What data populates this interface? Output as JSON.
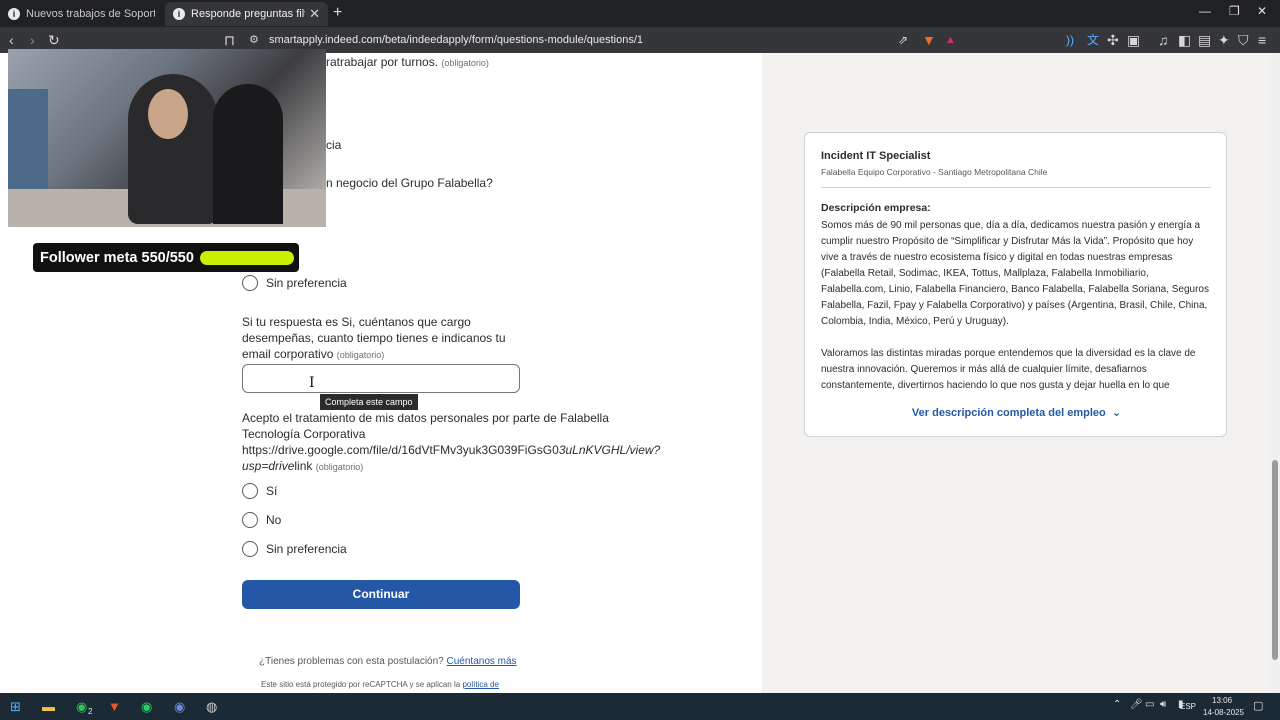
{
  "browser": {
    "tabs": [
      {
        "title": "Nuevos trabajos de Soporte IT en Sa",
        "active": false
      },
      {
        "title": "Responde preguntas filtro de la",
        "active": true
      }
    ],
    "url": "smartapply.indeed.com/beta/indeedapply/form/questions-module/questions/1"
  },
  "form": {
    "partial_q1_text": "ratrabajar por turnos.",
    "required_label": "(obligatorio)",
    "partial_option_text": "cia",
    "partial_q2_text": "n negocio del Grupo Falabella?",
    "q2_last_option": "Sin preferencia",
    "q3_text": "Si tu respuesta es Si, cuéntanos que cargo desempeñas, cuanto tiempo tienes e indicanos tu email corporativo",
    "q3_input_value": "",
    "tooltip": "Completa este campo",
    "q4_line1": "Acepto el tratamiento de mis datos personales por parte de Falabella Tecnología Corporativa",
    "q4_link_plain": "https://drive.google.com/file/d/16dVtFMv3yuk3G039FiGsG0",
    "q4_link_italic": "3uLnKVGHL/view?usp=drive",
    "q4_link_end": "link",
    "q4_options": [
      "Sí",
      "No",
      "Sin preferencia"
    ],
    "continue_button": "Continuar",
    "footer_question": "¿Tienes problemas con esta postulación?",
    "footer_link": "Cuéntanos más",
    "footer_recaptcha": "Este sitio está protegido por reCAPTCHA y se aplican la",
    "footer_recaptcha_link": "política de"
  },
  "job": {
    "title": "Incident IT Specialist",
    "company": "Falabella Equipo Corporativo - Santiago Metropolitana Chile",
    "desc_heading": "Descripción empresa:",
    "desc_p1": "Somos más de 90 mil personas que, día a día, dedicamos nuestra pasión y energía a cumplir nuestro Propósito de “Simplificar y Disfrutar Más la Vida”. Propósito que hoy vive a través de nuestro ecosistema físico y digital en todas nuestras empresas (Falabella Retail, Sodimac, IKEA, Tottus, Mallplaza, Falabella Inmobiliario, Falabella.com, Linio, Falabella Financiero, Banco Falabella, Falabella Soriana, Seguros Falabella, Fazil, Fpay y Falabella Corporativo) y países (Argentina, Brasil, Chile, China, Colombia, India, México, Perú y Uruguay).",
    "desc_p2": "Valoramos las distintas miradas porque entendemos que la diversidad es la clave de nuestra innovación. Queremos ir más allá de cualquier límite, desafiarnos constantemente, divertirnos haciendo lo que nos gusta y dejar huella en lo que hacemos. Y sabemos que",
    "see_full": "Ver descripción completa del empleo"
  },
  "overlay": {
    "follower_text": "Follower meta 550/550",
    "follower_progress": 1.0,
    "follower_bar_color": "#c8f000"
  },
  "taskbar": {
    "language": "ESP",
    "time": "13:06",
    "date": "14-08-2025",
    "whatsapp_badge": "2"
  }
}
